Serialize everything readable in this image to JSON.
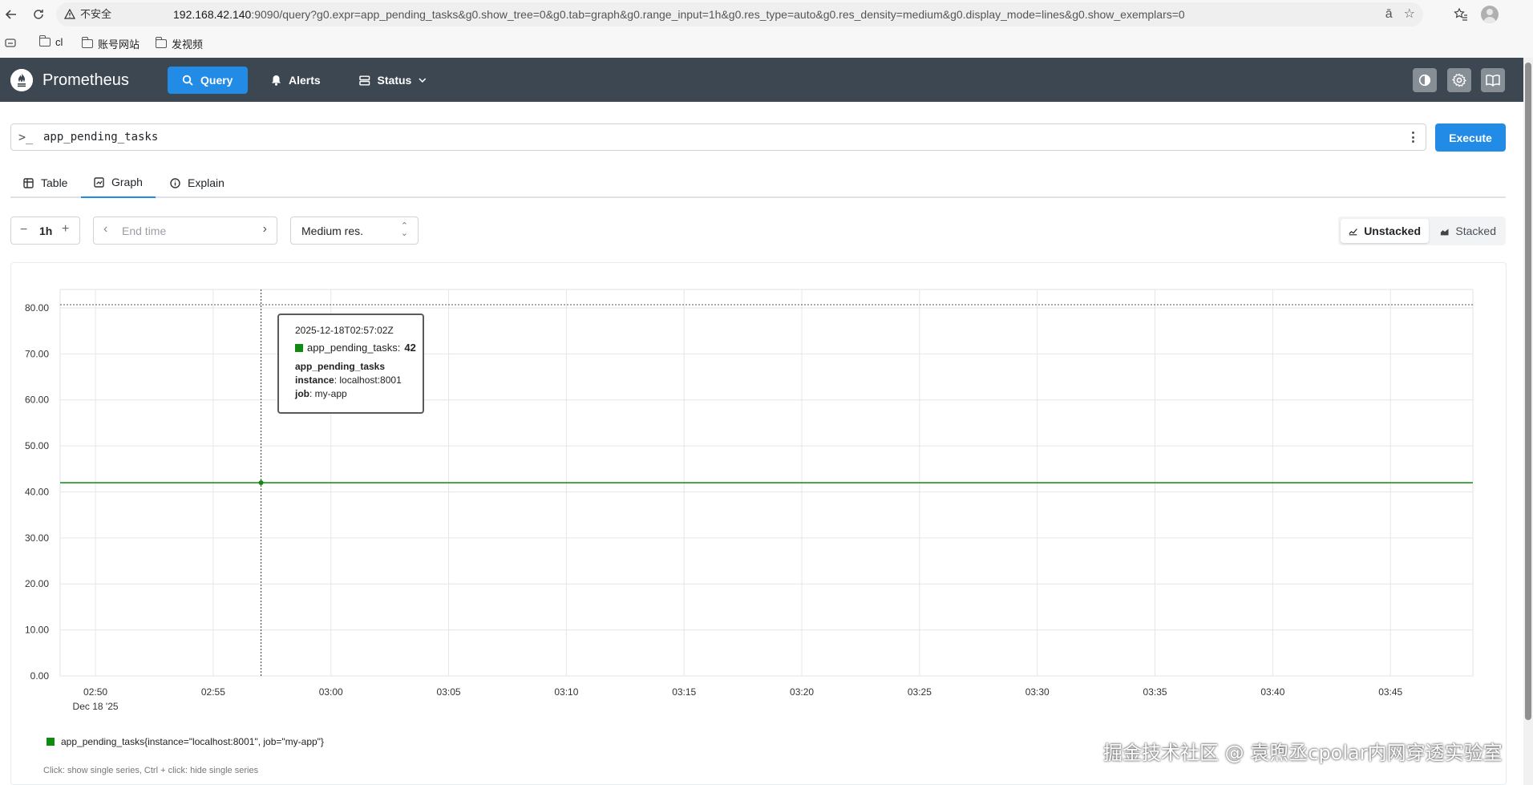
{
  "browser": {
    "security_label": "不安全",
    "url_host": "192.168.42.140",
    "url_rest": ":9090/query?g0.expr=app_pending_tasks&g0.show_tree=0&g0.tab=graph&g0.range_input=1h&g0.res_type=auto&g0.res_density=medium&g0.display_mode=lines&g0.show_exemplars=0",
    "bookmarks": [
      "cl",
      "账号网站",
      "发视频"
    ]
  },
  "navbar": {
    "brand": "Prometheus",
    "items": [
      {
        "label": "Query",
        "icon": "search-icon",
        "active": true
      },
      {
        "label": "Alerts",
        "icon": "bell-icon"
      },
      {
        "label": "Status",
        "icon": "server-icon"
      }
    ]
  },
  "query": {
    "expression": "app_pending_tasks",
    "execute_label": "Execute"
  },
  "tabs": [
    "Table",
    "Graph",
    "Explain"
  ],
  "controls": {
    "range": "1h",
    "end_time_placeholder": "End time",
    "resolution": "Medium res.",
    "unstacked_label": "Unstacked",
    "stacked_label": "Stacked"
  },
  "chart_data": {
    "type": "line",
    "x_ticks": [
      "02:50",
      "02:55",
      "03:00",
      "03:05",
      "03:10",
      "03:15",
      "03:20",
      "03:25",
      "03:30",
      "03:35",
      "03:40",
      "03:45"
    ],
    "x_date_label": "Dec 18 '25",
    "y_ticks": [
      "0.00",
      "10.00",
      "20.00",
      "30.00",
      "40.00",
      "50.00",
      "60.00",
      "70.00",
      "80.00"
    ],
    "ylim": [
      0,
      84
    ],
    "xlim": [
      "02:48:30",
      "03:48:30"
    ],
    "grid": true,
    "series": [
      {
        "name": "app_pending_tasks{instance=\"localhost:8001\", job=\"my-app\"}",
        "color": "#108a10",
        "x": [
          "02:48:30",
          "03:48:30"
        ],
        "values": [
          42,
          42
        ]
      }
    ],
    "hover": {
      "x": "02:57:02",
      "value": 42
    }
  },
  "tooltip": {
    "time": "2025-12-18T02:57:02Z",
    "series_label": "app_pending_tasks:",
    "value": "42",
    "metric": "app_pending_tasks",
    "instance_key": "instance",
    "instance_val": ": localhost:8001",
    "job_key": "job",
    "job_val": ": my-app"
  },
  "legend": {
    "series": "app_pending_tasks{instance=\"localhost:8001\", job=\"my-app\"}",
    "hint": "Click: show single series, Ctrl + click: hide single series"
  },
  "watermark": "掘金技术社区 @ 袁煦丞cpolar内网穿透实验室"
}
